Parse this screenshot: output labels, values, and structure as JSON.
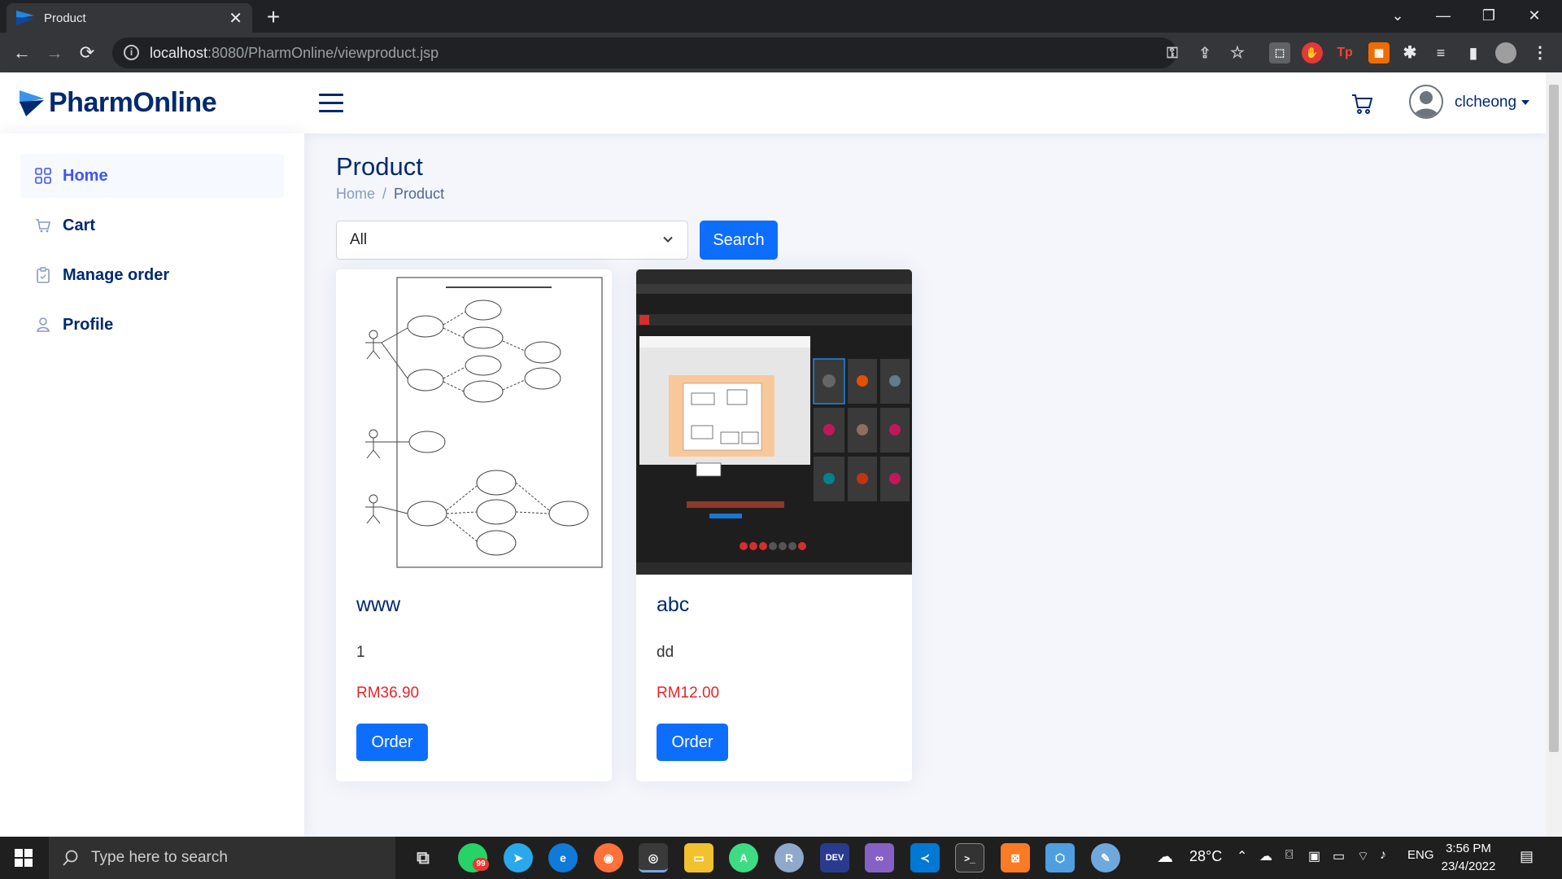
{
  "browser": {
    "tab_title": "Product",
    "tab_close": "✕",
    "new_tab": "+",
    "url_host": "localhost",
    "url_path": ":8080/PharmOnline/viewproduct.jsp"
  },
  "header": {
    "brand": "PharmOnline",
    "username": "clcheong"
  },
  "sidebar": {
    "items": [
      {
        "label": "Home",
        "icon": "grid-icon",
        "active": true
      },
      {
        "label": "Cart",
        "icon": "cart-icon",
        "active": false
      },
      {
        "label": "Manage order",
        "icon": "clipboard-icon",
        "active": false
      },
      {
        "label": "Profile",
        "icon": "person-icon",
        "active": false
      }
    ]
  },
  "main": {
    "title": "Product",
    "breadcrumb": [
      "Home",
      "/",
      "Product"
    ],
    "filter": {
      "selected": "All"
    },
    "search_label": "Search",
    "products": [
      {
        "name": "www",
        "description": "1",
        "price": "RM36.90",
        "order_label": "Order",
        "image": "use case diagram - Record and File Management System"
      },
      {
        "name": "abc",
        "description": "dd",
        "price": "RM12.00",
        "order_label": "Order",
        "image": "video meeting screenshot"
      }
    ]
  },
  "taskbar": {
    "search_placeholder": "Type here to search",
    "whatsapp_badge": "99",
    "weather": "28°C",
    "language": "ENG",
    "time": "3:56 PM",
    "date": "23/4/2022"
  },
  "colors": {
    "brand": "#012970",
    "primary": "#0d6efd",
    "price": "#e2262b",
    "active_nav": "#4154f1"
  }
}
